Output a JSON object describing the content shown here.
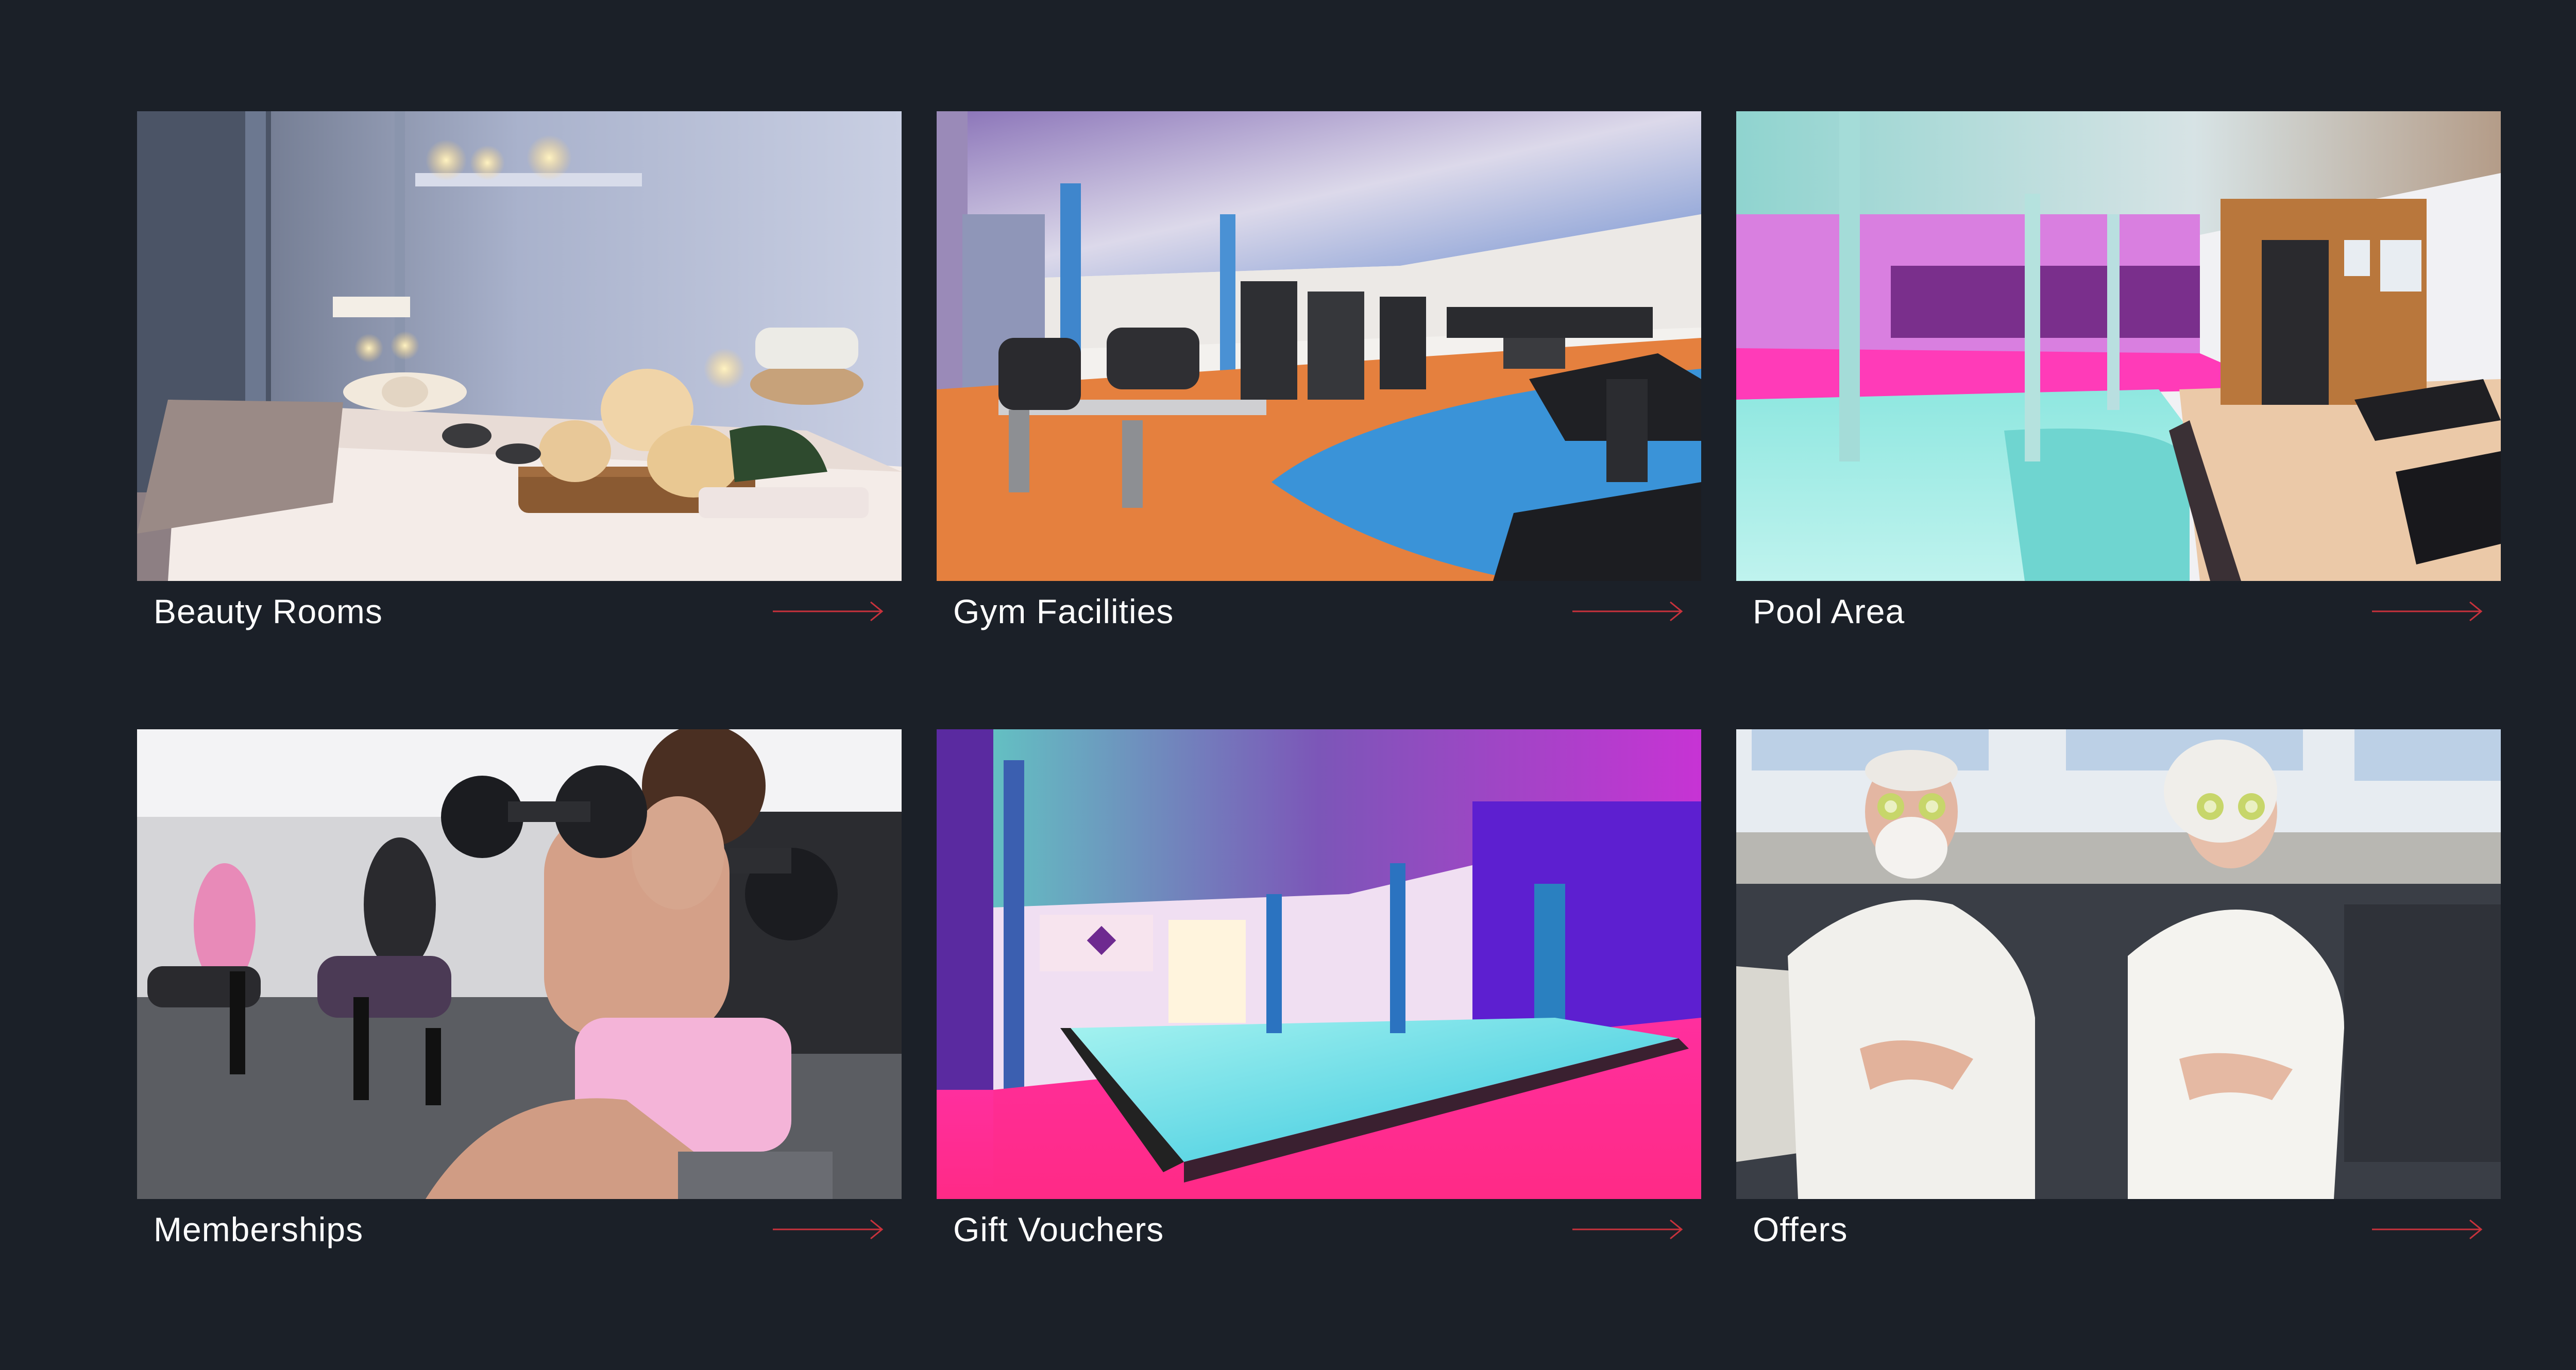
{
  "cards": [
    {
      "label": "Beauty Rooms",
      "image": "spa massage table with rolled towels, stones and candles",
      "icon": "arrow-right-icon"
    },
    {
      "label": "Gym Facilities",
      "image": "gym with rowing machines, treadmills on orange and blue floor",
      "icon": "arrow-right-icon"
    },
    {
      "label": "Pool Area",
      "image": "indoor pool with columns, wooden sauna and loungers",
      "icon": "arrow-right-icon"
    },
    {
      "label": "Memberships",
      "image": "woman exercising with dumbbells in a fitness class",
      "icon": "arrow-right-icon"
    },
    {
      "label": "Gift Vouchers",
      "image": "indoor swimming pool lit in pink and purple",
      "icon": "arrow-right-icon"
    },
    {
      "label": "Offers",
      "image": "elderly couple in white bathrobes with cucumber slices on eyes",
      "icon": "arrow-right-icon"
    }
  ],
  "colors": {
    "background": "#1b2028",
    "label_text": "#ffffff",
    "arrow_accent": "#c8323c"
  }
}
